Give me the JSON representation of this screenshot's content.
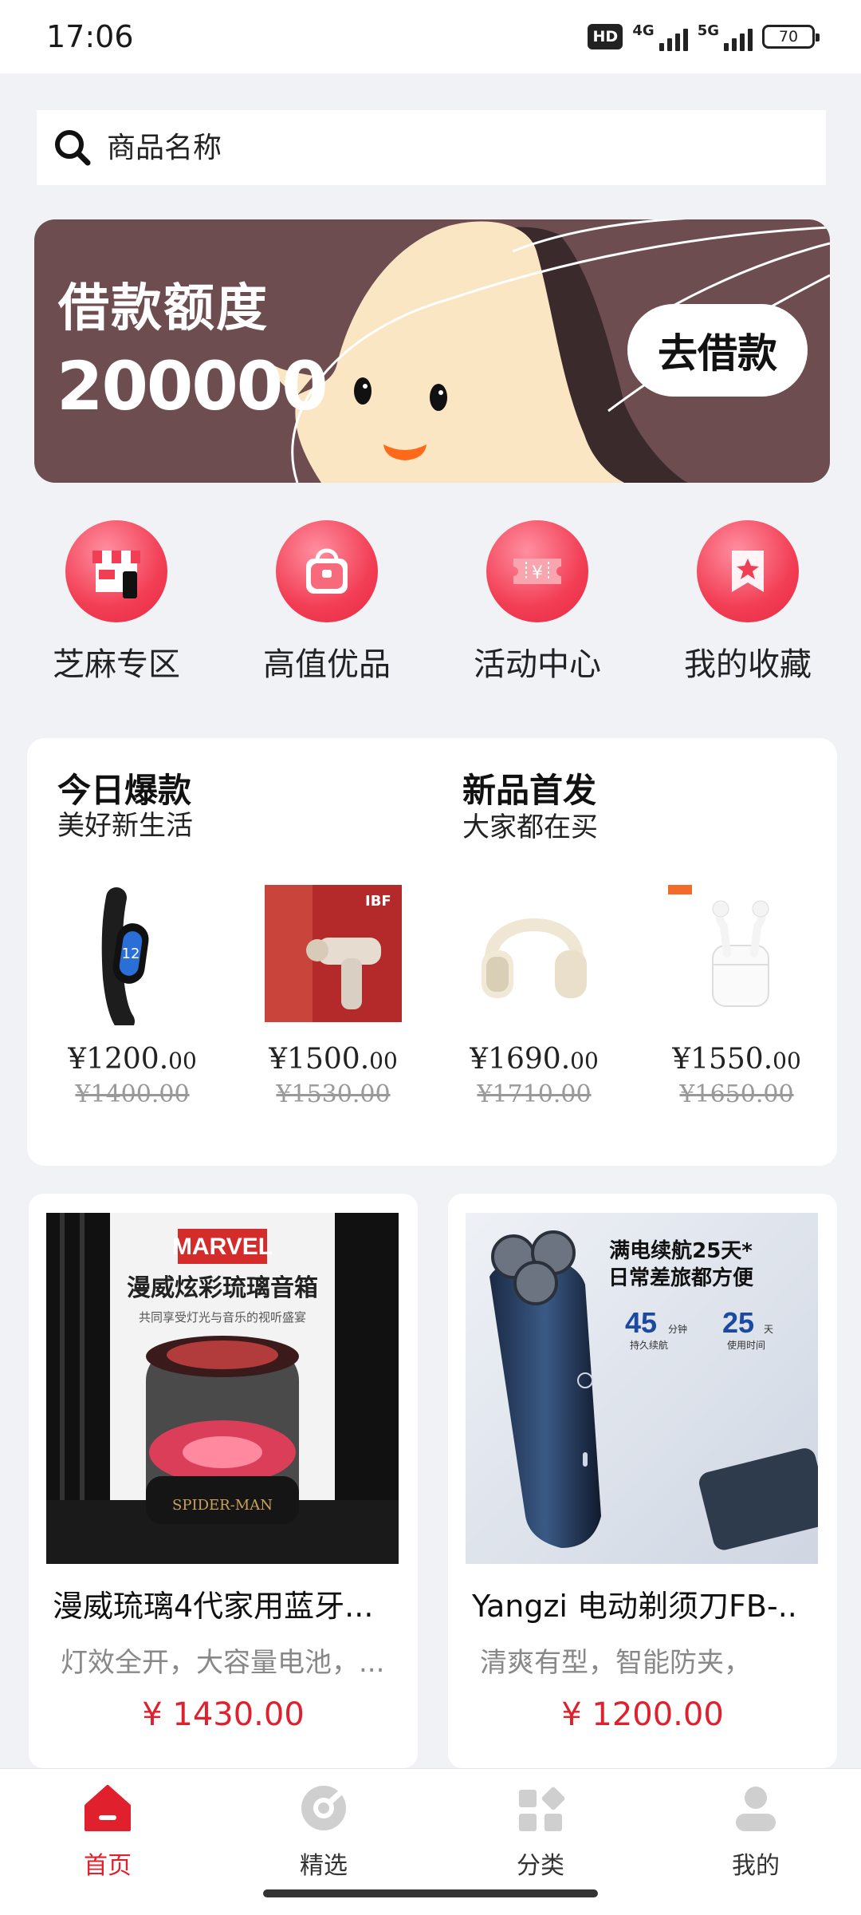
{
  "status_bar": {
    "time": "17:06",
    "hd_label": "HD",
    "net1_label": "4G",
    "net2_label": "5G",
    "battery": "70"
  },
  "search": {
    "placeholder": "商品名称"
  },
  "banner": {
    "title": "借款额度",
    "amount": "200000",
    "button_label": "去借款",
    "bg_color": "#6d4d50"
  },
  "quick_nav": [
    {
      "label": "芝麻专区",
      "icon": "store-icon"
    },
    {
      "label": "高值优品",
      "icon": "bag-icon"
    },
    {
      "label": "活动中心",
      "icon": "ticket-icon"
    },
    {
      "label": "我的收藏",
      "icon": "star-bookmark-icon"
    }
  ],
  "hot_section": {
    "left_title": "今日爆款",
    "left_subtitle": "美好新生活",
    "right_title": "新品首发",
    "right_subtitle": "大家都在买",
    "products": [
      {
        "price_int": "¥1200.",
        "price_cents": "00",
        "old_price": "¥1400.00"
      },
      {
        "price_int": "¥1500.",
        "price_cents": "00",
        "old_price": "¥1530.00"
      },
      {
        "price_int": "¥1690.",
        "price_cents": "00",
        "old_price": "¥1710.00"
      },
      {
        "price_int": "¥1550.",
        "price_cents": "00",
        "old_price": "¥1650.00"
      }
    ]
  },
  "feed": [
    {
      "name": "漫威琉璃4代家用蓝牙...",
      "desc": "灯效全开，大容量电池，...",
      "price": "¥ 1430.00",
      "img_brand": "MARVEL",
      "img_title": "漫威炫彩琉璃音箱",
      "img_sub": "共同享受灯光与音乐的视听盛宴",
      "img_base": "SPIDER-MAN"
    },
    {
      "name": "Yangzi 电动剃须刀FB-..",
      "desc": "清爽有型，智能防夹，",
      "price": "¥ 1200.00",
      "img_line1": "满电续航25天*",
      "img_line2": "日常差旅都方便",
      "img_stat1_num": "45",
      "img_stat1_unit": "分钟",
      "img_stat1_label": "持久续航",
      "img_stat2_num": "25",
      "img_stat2_unit": "天",
      "img_stat2_label": "使用时间"
    }
  ],
  "tabbar": [
    {
      "label": "首页",
      "icon": "home-icon",
      "active": true
    },
    {
      "label": "精选",
      "icon": "featured-icon",
      "active": false
    },
    {
      "label": "分类",
      "icon": "category-icon",
      "active": false
    },
    {
      "label": "我的",
      "icon": "profile-icon",
      "active": false
    }
  ],
  "colors": {
    "accent": "#e0202c",
    "icon_red": "#f23e55",
    "page_bg": "#f1f2f6"
  }
}
